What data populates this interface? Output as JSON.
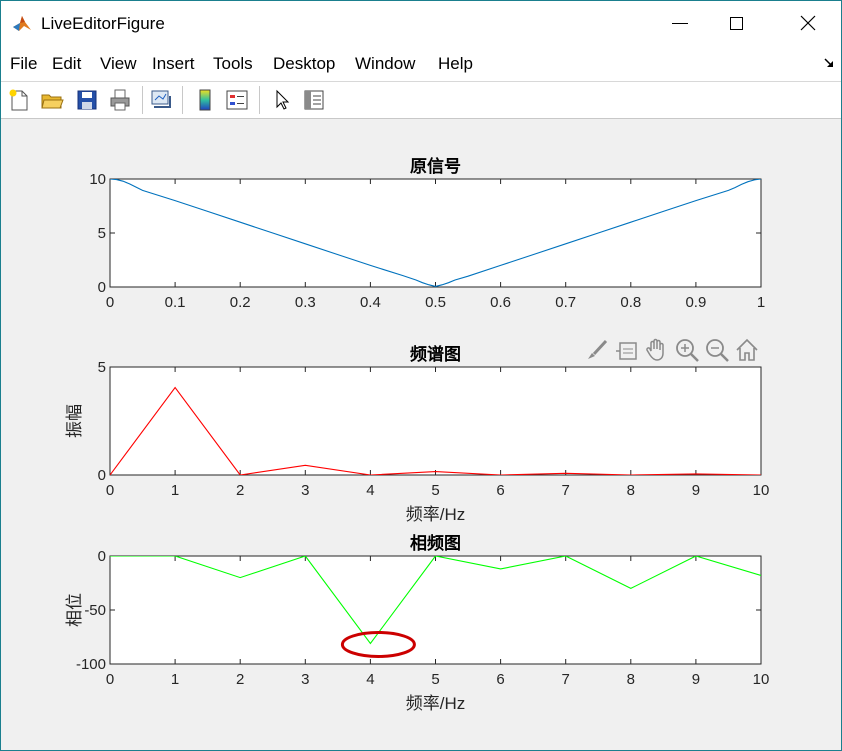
{
  "window": {
    "title": "LiveEditorFigure",
    "minimize_glyph": "—",
    "close_glyph": "✕"
  },
  "menu": [
    "File",
    "Edit",
    "View",
    "Insert",
    "Tools",
    "Desktop",
    "Window",
    "Help"
  ],
  "toolbar_icons": [
    "new-figure-icon",
    "open-file-icon",
    "save-icon",
    "print-icon",
    "link-plot-icon",
    "colorbar-icon",
    "legend-icon",
    "pointer-icon",
    "property-inspector-icon"
  ],
  "axes_toolbar_icons": [
    "brush-icon",
    "data-tip-icon",
    "pan-hand-icon",
    "zoom-in-icon",
    "zoom-out-icon",
    "home-icon"
  ],
  "colors": {
    "signal": "#0072bd",
    "magnitude": "#ff0000",
    "phase": "#00ff00",
    "annotation": "#cc0000"
  },
  "chart_data": [
    {
      "type": "line",
      "title": "原信号",
      "xlabel": "",
      "ylabel": "",
      "xlim": [
        0,
        1
      ],
      "ylim": [
        0,
        10
      ],
      "xticks": [
        0,
        0.1,
        0.2,
        0.3,
        0.4,
        0.5,
        0.6,
        0.7,
        0.8,
        0.9,
        1
      ],
      "xtick_labels": [
        "0",
        "0.1",
        "0.2",
        "0.3",
        "0.4",
        "0.5",
        "0.6",
        "0.7",
        "0.8",
        "0.9",
        "1"
      ],
      "yticks": [
        0,
        5,
        10
      ],
      "ytick_labels": [
        "0",
        "5",
        "10"
      ],
      "x": [
        0,
        0.01,
        0.02,
        0.03,
        0.04,
        0.05,
        0.1,
        0.15,
        0.2,
        0.25,
        0.3,
        0.35,
        0.4,
        0.45,
        0.47,
        0.48,
        0.49,
        0.5,
        0.51,
        0.52,
        0.53,
        0.55,
        0.6,
        0.65,
        0.7,
        0.75,
        0.8,
        0.85,
        0.9,
        0.95,
        0.96,
        0.97,
        0.98,
        0.99,
        1
      ],
      "y": [
        10,
        9.95,
        9.8,
        9.55,
        9.25,
        8.95,
        8.0,
        7.0,
        6.0,
        5.0,
        4.0,
        3.0,
        2.0,
        1.05,
        0.65,
        0.4,
        0.2,
        0.05,
        0.2,
        0.4,
        0.65,
        1.0,
        2.0,
        3.0,
        4.0,
        5.0,
        6.0,
        7.0,
        8.0,
        8.95,
        9.2,
        9.5,
        9.75,
        9.92,
        10
      ]
    },
    {
      "type": "line",
      "title": "频谱图",
      "xlabel": "频率/Hz",
      "ylabel": "振幅",
      "xlim": [
        0,
        10
      ],
      "ylim": [
        0,
        5
      ],
      "xticks": [
        0,
        1,
        2,
        3,
        4,
        5,
        6,
        7,
        8,
        9,
        10
      ],
      "xtick_labels": [
        "0",
        "1",
        "2",
        "3",
        "4",
        "5",
        "6",
        "7",
        "8",
        "9",
        "10"
      ],
      "yticks": [
        0,
        5
      ],
      "ytick_labels": [
        "0",
        "5"
      ],
      "x": [
        0,
        1,
        2,
        3,
        4,
        5,
        6,
        7,
        8,
        9,
        10
      ],
      "y": [
        0,
        4.05,
        0,
        0.45,
        0,
        0.16,
        0,
        0.08,
        0,
        0.05,
        0
      ]
    },
    {
      "type": "line",
      "title": "相频图",
      "xlabel": "频率/Hz",
      "ylabel": "相位",
      "xlim": [
        0,
        10
      ],
      "ylim": [
        -100,
        0
      ],
      "xticks": [
        0,
        1,
        2,
        3,
        4,
        5,
        6,
        7,
        8,
        9,
        10
      ],
      "xtick_labels": [
        "0",
        "1",
        "2",
        "3",
        "4",
        "5",
        "6",
        "7",
        "8",
        "9",
        "10"
      ],
      "yticks": [
        -100,
        -50,
        0
      ],
      "ytick_labels": [
        "-100",
        "-50",
        "0"
      ],
      "x": [
        0,
        1,
        2,
        3,
        4,
        5,
        6,
        7,
        8,
        9,
        10
      ],
      "y": [
        0,
        0,
        -20,
        0,
        -81,
        0,
        -12,
        0,
        -30,
        0,
        -18
      ],
      "highlight": {
        "x": 4,
        "y": -81
      }
    }
  ]
}
